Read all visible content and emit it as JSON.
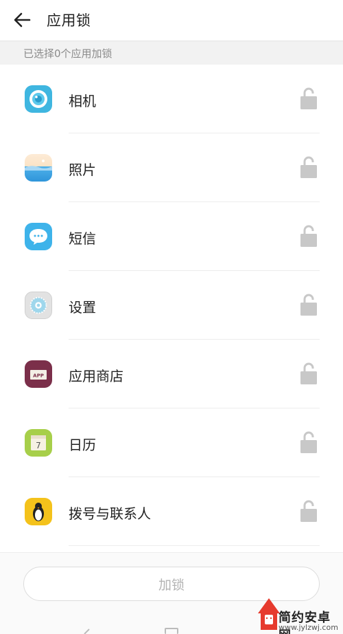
{
  "header": {
    "title": "应用锁"
  },
  "subheader": {
    "text": "已选择0个应用加锁"
  },
  "apps": [
    {
      "label": "相机",
      "icon": "camera-icon",
      "color": "#3fb6e0"
    },
    {
      "label": "照片",
      "icon": "photos-icon",
      "color": "#46a8e6"
    },
    {
      "label": "短信",
      "icon": "messages-icon",
      "color": "#3eb3ea"
    },
    {
      "label": "设置",
      "icon": "settings-icon",
      "color": "#d9d9d9"
    },
    {
      "label": "应用商店",
      "icon": "app-store-icon",
      "color": "#7b2f4a"
    },
    {
      "label": "日历",
      "icon": "calendar-icon",
      "color": "#a7cf4a"
    },
    {
      "label": "拨号与联系人",
      "icon": "dialer-contacts-icon",
      "color": "#f4c21b"
    }
  ],
  "calendar_day": "7",
  "store_badge": "APP",
  "button": {
    "label": "加锁"
  },
  "watermark": {
    "brand": "简约安卓网",
    "url": "www.jylzwj.com"
  },
  "colors": {
    "lock": "#c8c8c8",
    "divider": "#ececec",
    "subheader_bg": "#f2f2f2"
  }
}
